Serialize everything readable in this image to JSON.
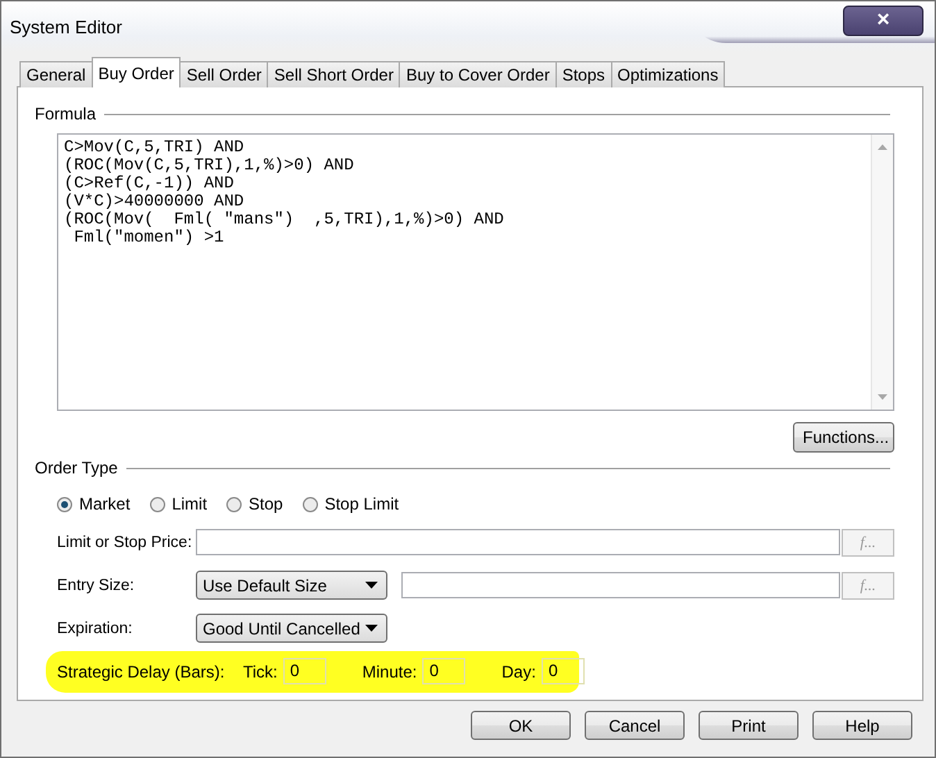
{
  "window": {
    "title": "System Editor",
    "close": "×"
  },
  "tabs": [
    {
      "label": "General",
      "selected": false
    },
    {
      "label": "Buy Order",
      "selected": true
    },
    {
      "label": "Sell Order",
      "selected": false
    },
    {
      "label": "Sell Short Order",
      "selected": false
    },
    {
      "label": "Buy to Cover Order",
      "selected": false
    },
    {
      "label": "Stops",
      "selected": false
    },
    {
      "label": "Optimizations",
      "selected": false
    }
  ],
  "formula": {
    "label": "Formula",
    "lines": [
      "C>Mov(C,5,TRI) AND",
      "(ROC(Mov(C,5,TRI),1,%)>0) AND",
      "(C>Ref(C,-1)) AND",
      "(V*C)>40000000 AND",
      "(ROC(Mov(  Fml( \"mans\")  ,5,TRI),1,%)>0) AND",
      " Fml(\"momen\") >1"
    ],
    "button": "Functions..."
  },
  "order_type": {
    "label": "Order Type",
    "options": [
      {
        "label": "Market",
        "selected": true
      },
      {
        "label": "Limit",
        "selected": false
      },
      {
        "label": "Stop",
        "selected": false
      },
      {
        "label": "Stop Limit",
        "selected": false
      }
    ]
  },
  "fields": [
    {
      "label": "Limit or Stop Price:",
      "kind": "text",
      "fx": "f..."
    },
    {
      "label": "Entry Size:",
      "kind": "dropdown-text",
      "dropdown": "Use Default Size",
      "fx": "f..."
    },
    {
      "label": "Expiration:",
      "kind": "dropdown",
      "dropdown": "Good Until Cancelled"
    }
  ],
  "strategic_delay": {
    "label": "Strategic Delay (Bars):",
    "highlighted": true,
    "inputs": [
      {
        "label": "Tick:",
        "value": "0"
      },
      {
        "label": "Minute:",
        "value": "0"
      },
      {
        "label": "Day:",
        "value": "0"
      }
    ]
  },
  "buttons": [
    "OK",
    "Cancel",
    "Print",
    "Help"
  ]
}
